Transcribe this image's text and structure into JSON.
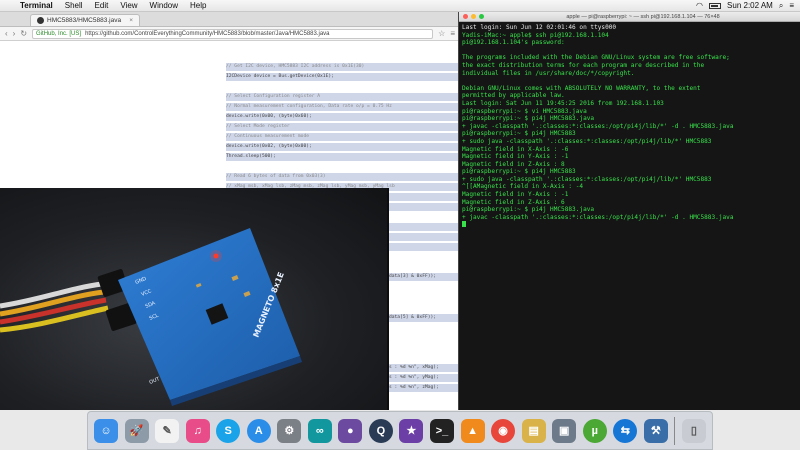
{
  "menubar": {
    "apple": "",
    "items": [
      "Terminal",
      "Shell",
      "Edit",
      "View",
      "Window",
      "Help"
    ],
    "datetime": "Sun 2:02 AM"
  },
  "browser": {
    "tab_title": "HMC5883/HMC5883.java",
    "secure_label": "GitHub, Inc. [US]",
    "url": "https://github.com/ControlEverythingCommunity/HMC5883/blob/master/Java/HMC5883.java",
    "code_lines": [
      {
        "text": "// Get I2C device, HMC5883 I2C address is 0x1E(30)",
        "hl": true,
        "cm": true
      },
      {
        "text": "I2CDevice device = Bus.getDevice(0x1E);",
        "hl": true,
        "cm": false
      },
      {
        "text": "",
        "hl": false,
        "cm": false
      },
      {
        "text": "// Select Configuration register A",
        "hl": true,
        "cm": true
      },
      {
        "text": "// Normal measurement configuration, Data rate o/p = 0.75 Hz",
        "hl": true,
        "cm": true
      },
      {
        "text": "device.write(0x00, (byte)0x60);",
        "hl": true,
        "cm": false
      },
      {
        "text": "// Select Mode register",
        "hl": true,
        "cm": true
      },
      {
        "text": "// Continuous measurement mode",
        "hl": true,
        "cm": true
      },
      {
        "text": "device.write(0x02, (byte)0x00);",
        "hl": true,
        "cm": false
      },
      {
        "text": "Thread.sleep(500);",
        "hl": true,
        "cm": false
      },
      {
        "text": "",
        "hl": false,
        "cm": false
      },
      {
        "text": "// Read 6 bytes of data from 0x03(3)",
        "hl": true,
        "cm": true
      },
      {
        "text": "// xMag msb, xMag lsb, zMag msb, zMag lsb, yMag msb, yMag lsb",
        "hl": true,
        "cm": true
      },
      {
        "text": "byte[] data = new byte[6];",
        "hl": true,
        "cm": false
      },
      {
        "text": "device.read(0x03, data, 0, 6);",
        "hl": true,
        "cm": false
      },
      {
        "text": "",
        "hl": false,
        "cm": false
      },
      {
        "text": "// Convert the data",
        "hl": true,
        "cm": true
      },
      {
        "text": "int xMag = ((data[0] & 0xFF) * 256 + (data[1] & 0xFF));",
        "hl": true,
        "cm": false
      },
      {
        "text": "if(xMag > 32767)",
        "hl": true,
        "cm": false
      },
      {
        "text": "{",
        "hl": false,
        "cm": false
      }
    ],
    "code_fragments": [
      {
        "text": "data[3] & 0xFF));"
      },
      {
        "text": "data[5] & 0xFF));"
      },
      {
        "text": "s : %d %n\", xMag);"
      },
      {
        "text": "s : %d %n\", yMag);"
      },
      {
        "text": "s : %d %n\", zMag);"
      }
    ]
  },
  "photo": {
    "board_label": "MAGNETO 8x1E",
    "pin_labels": [
      "GND",
      "VCC",
      "SDA",
      "SCL",
      "OUT"
    ]
  },
  "terminal": {
    "title": "apple — pi@raspberrypi: ~ — ssh pi@192.168.1.104 — 76×48",
    "lines": [
      {
        "text": "Last login: Sun Jun 12 02:01:46 on ttys000",
        "w": true
      },
      {
        "text": "Yadis-iMac:~ apple$ ssh pi@192.168.1.104",
        "w": false
      },
      {
        "text": "pi@192.168.1.104's password:",
        "w": false
      },
      {
        "text": "",
        "w": false
      },
      {
        "text": "The programs included with the Debian GNU/Linux system are free software;",
        "w": false
      },
      {
        "text": "the exact distribution terms for each program are described in the",
        "w": false
      },
      {
        "text": "individual files in /usr/share/doc/*/copyright.",
        "w": false
      },
      {
        "text": "",
        "w": false
      },
      {
        "text": "Debian GNU/Linux comes with ABSOLUTELY NO WARRANTY, to the extent",
        "w": false
      },
      {
        "text": "permitted by applicable law.",
        "w": false
      },
      {
        "text": "Last login: Sat Jun 11 19:45:25 2016 from 192.168.1.103",
        "w": false
      },
      {
        "text": "pi@raspberrypi:~ $ vi HMC5883.java",
        "w": false
      },
      {
        "text": "pi@raspberrypi:~ $ pi4j HMC5883.java",
        "w": false
      },
      {
        "text": "+ javac -classpath '.:classes:*:classes:/opt/pi4j/lib/*' -d . HMC5883.java",
        "w": false
      },
      {
        "text": "pi@raspberrypi:~ $ pi4j HMC5883",
        "w": false
      },
      {
        "text": "+ sudo java -classpath '.:classes:*:classes:/opt/pi4j/lib/*' HMC5883",
        "w": false
      },
      {
        "text": "Magnetic field in X-Axis : -6",
        "w": false
      },
      {
        "text": "Magnetic field in Y-Axis : -1",
        "w": false
      },
      {
        "text": "Magnetic field in Z-Axis : 8",
        "w": false
      },
      {
        "text": "pi@raspberrypi:~ $ pi4j HMC5883",
        "w": false
      },
      {
        "text": "+ sudo java -classpath '.:classes:*:classes:/opt/pi4j/lib/*' HMC5883",
        "w": false
      },
      {
        "text": "^[[AMagnetic field in X-Axis : -4",
        "w": false
      },
      {
        "text": "Magnetic field in Y-Axis : -1",
        "w": false
      },
      {
        "text": "Magnetic field in Z-Axis : 6",
        "w": false
      },
      {
        "text": "pi@raspberrypi:~ $ pi4j HMC5883.java",
        "w": false
      },
      {
        "text": "+ javac -classpath '.:classes:*:classes:/opt/pi4j/lib/*' -d . HMC5883.java",
        "w": false
      }
    ]
  },
  "dock": {
    "apps": [
      {
        "icon": "finder-icon",
        "glyph": "☺",
        "color": "#3b8fe8"
      },
      {
        "icon": "launchpad-icon",
        "glyph": "🚀",
        "color": "#8d9aa7"
      },
      {
        "icon": "textedit-icon",
        "glyph": "✎",
        "color": "#f2f2f2"
      },
      {
        "icon": "itunes-icon",
        "glyph": "♫",
        "color": "#e84d8a"
      },
      {
        "icon": "skype-icon",
        "glyph": "S",
        "color": "#1aa3e8"
      },
      {
        "icon": "appstore-icon",
        "glyph": "A",
        "color": "#2a8ee8"
      },
      {
        "icon": "system-preferences-icon",
        "glyph": "⚙",
        "color": "#7b7f86"
      },
      {
        "icon": "arduino-icon",
        "glyph": "∞",
        "color": "#12979e"
      },
      {
        "icon": "github-icon",
        "glyph": "●",
        "color": "#6b4aa0"
      },
      {
        "icon": "quicktime-icon",
        "glyph": "Q",
        "color": "#2a3b55"
      },
      {
        "icon": "imovie-icon",
        "glyph": "★",
        "color": "#6b3fa5"
      },
      {
        "icon": "terminal-icon",
        "glyph": ">_",
        "color": "#222222"
      },
      {
        "icon": "vlc-icon",
        "glyph": "▲",
        "color": "#f08a1c"
      },
      {
        "icon": "chrome-icon",
        "glyph": "◉",
        "color": "#e8463a"
      },
      {
        "icon": "archive-utility-icon",
        "glyph": "▤",
        "color": "#d9b34a"
      },
      {
        "icon": "screenshot-icon",
        "glyph": "▣",
        "color": "#6d7a8a"
      },
      {
        "icon": "utorrent-icon",
        "glyph": "µ",
        "color": "#4ba834"
      },
      {
        "icon": "teamviewer-icon",
        "glyph": "⇆",
        "color": "#1576d6"
      },
      {
        "icon": "xcode-icon",
        "glyph": "⚒",
        "color": "#3a6ea8"
      },
      {
        "icon": "trash-icon",
        "glyph": "▯",
        "color": "#c8ccd2"
      }
    ]
  }
}
